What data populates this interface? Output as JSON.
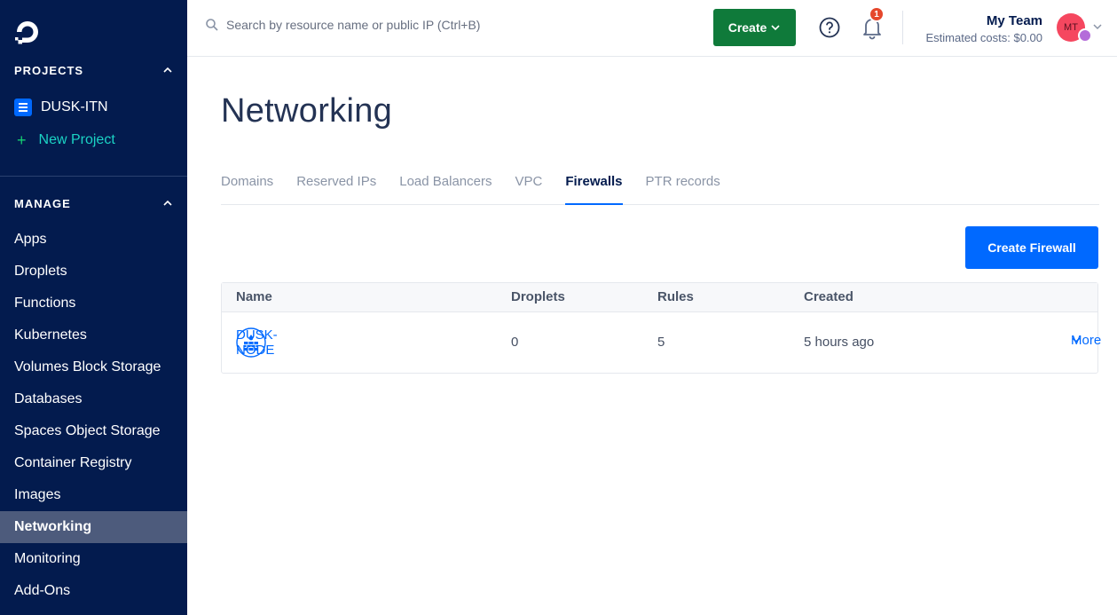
{
  "sidebar": {
    "projects_heading": "PROJECTS",
    "project_name": "DUSK-ITN",
    "new_project_label": "New Project",
    "manage_heading": "MANAGE",
    "items": [
      {
        "label": "Apps"
      },
      {
        "label": "Droplets"
      },
      {
        "label": "Functions"
      },
      {
        "label": "Kubernetes"
      },
      {
        "label": "Volumes Block Storage"
      },
      {
        "label": "Databases"
      },
      {
        "label": "Spaces Object Storage"
      },
      {
        "label": "Container Registry"
      },
      {
        "label": "Images"
      },
      {
        "label": "Networking",
        "active": true
      },
      {
        "label": "Monitoring"
      },
      {
        "label": "Add-Ons"
      }
    ],
    "colors": {
      "background": "#031b4e",
      "active": "#4d5b7c",
      "new_project": "#1bd3c4"
    }
  },
  "header": {
    "search_placeholder": "Search by resource name or public IP (Ctrl+B)",
    "create_label": "Create",
    "notification_count": "1",
    "team_name": "My Team",
    "estimated_costs": "Estimated costs: $0.00",
    "avatar_initials": "MT",
    "colors": {
      "create": "#0f7a3a",
      "badge": "#e5472c",
      "avatar": "#f5475f"
    }
  },
  "main": {
    "title": "Networking",
    "tabs": [
      {
        "label": "Domains"
      },
      {
        "label": "Reserved IPs"
      },
      {
        "label": "Load Balancers"
      },
      {
        "label": "VPC"
      },
      {
        "label": "Firewalls",
        "active": true
      },
      {
        "label": "PTR records"
      }
    ],
    "create_firewall_label": "Create Firewall",
    "table": {
      "columns": [
        "Name",
        "Droplets",
        "Rules",
        "Created"
      ],
      "rows": [
        {
          "name": "DUSK-NODE",
          "droplets": "0",
          "rules": "5",
          "created": "5 hours ago",
          "action": "More"
        }
      ]
    },
    "colors": {
      "primary": "#0069ff"
    }
  }
}
